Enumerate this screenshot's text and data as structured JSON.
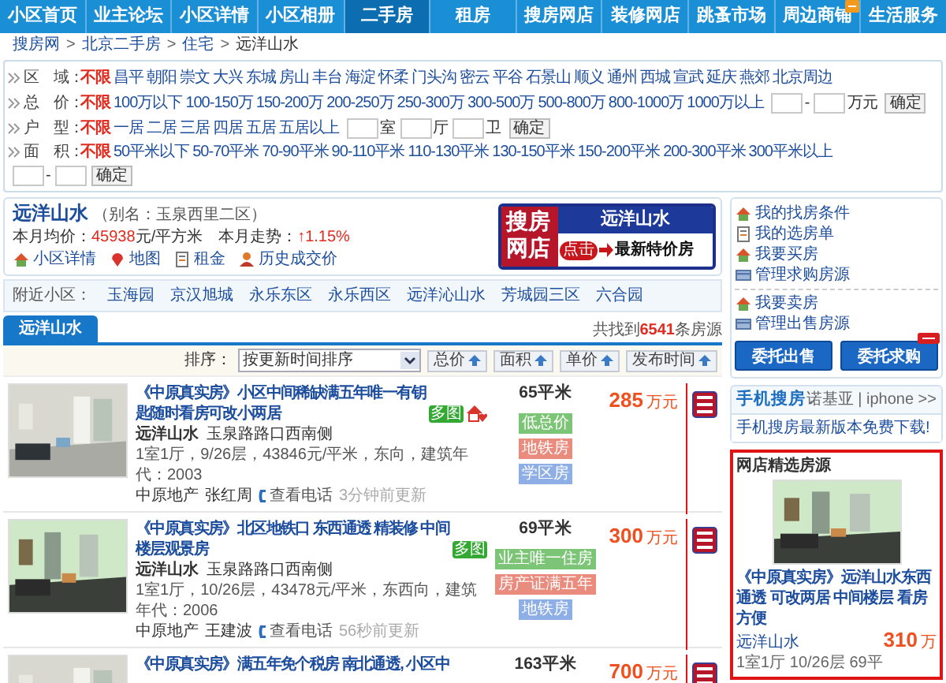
{
  "nav": [
    {
      "label": "小区首页",
      "selected": false,
      "badge": false
    },
    {
      "label": "业主论坛",
      "selected": false,
      "badge": false
    },
    {
      "label": "小区详情",
      "selected": false,
      "badge": false
    },
    {
      "label": "小区相册",
      "selected": false,
      "badge": false
    },
    {
      "label": "二手房",
      "selected": true,
      "badge": false
    },
    {
      "label": "租房",
      "selected": false,
      "badge": false
    },
    {
      "label": "搜房网店",
      "selected": false,
      "badge": false
    },
    {
      "label": "装修网店",
      "selected": false,
      "badge": false
    },
    {
      "label": "跳蚤市场",
      "selected": false,
      "badge": false
    },
    {
      "label": "周边商铺",
      "selected": false,
      "badge": true
    },
    {
      "label": "生活服务",
      "selected": false,
      "badge": false
    }
  ],
  "breadcrumb": {
    "separator": ">",
    "items": [
      "搜房网",
      "北京二手房",
      "住宅"
    ],
    "current": "远洋山水"
  },
  "filters": [
    {
      "label": "区　域：",
      "options": [
        {
          "label": "不限",
          "selected": true
        },
        {
          "label": "昌平",
          "selected": false
        },
        {
          "label": "朝阳",
          "selected": false
        },
        {
          "label": "崇文",
          "selected": false
        },
        {
          "label": "大兴",
          "selected": false
        },
        {
          "label": "东城",
          "selected": false
        },
        {
          "label": "房山",
          "selected": false
        },
        {
          "label": "丰台",
          "selected": false
        },
        {
          "label": "海淀",
          "selected": false
        },
        {
          "label": "怀柔",
          "selected": false
        },
        {
          "label": "门头沟",
          "selected": false
        },
        {
          "label": "密云",
          "selected": false
        },
        {
          "label": "平谷",
          "selected": false
        },
        {
          "label": "石景山",
          "selected": false
        },
        {
          "label": "顺义",
          "selected": false
        },
        {
          "label": "通州",
          "selected": false
        },
        {
          "label": "西城",
          "selected": false
        },
        {
          "label": "宣武",
          "selected": false
        },
        {
          "label": "延庆",
          "selected": false
        },
        {
          "label": "燕郊",
          "selected": false
        },
        {
          "label": "北京周边",
          "selected": false
        }
      ]
    },
    {
      "label": "总　价：",
      "options": [
        {
          "label": "不限",
          "selected": true
        },
        {
          "label": "100万以下",
          "selected": false
        },
        {
          "label": "100-150万",
          "selected": false
        },
        {
          "label": "150-200万",
          "selected": false
        },
        {
          "label": "200-250万",
          "selected": false
        },
        {
          "label": "250-300万",
          "selected": false
        },
        {
          "label": "300-500万",
          "selected": false
        },
        {
          "label": "500-800万",
          "selected": false
        },
        {
          "label": "800-1000万",
          "selected": false
        },
        {
          "label": "1000万以上",
          "selected": false
        }
      ],
      "inputs": [
        {
          "kind": "field",
          "after": "-"
        },
        {
          "kind": "field",
          "after": "万元"
        }
      ],
      "button": "确定"
    },
    {
      "label": "户　型：",
      "options": [
        {
          "label": "不限",
          "selected": true
        },
        {
          "label": "一居",
          "selected": false
        },
        {
          "label": "二居",
          "selected": false
        },
        {
          "label": "三居",
          "selected": false
        },
        {
          "label": "四居",
          "selected": false
        },
        {
          "label": "五居",
          "selected": false
        },
        {
          "label": "五居以上",
          "selected": false
        }
      ],
      "inputs": [
        {
          "kind": "field",
          "after": "室"
        },
        {
          "kind": "field",
          "after": "厅"
        },
        {
          "kind": "field",
          "after": "卫"
        }
      ],
      "button": "确定"
    },
    {
      "label": "面　积：",
      "options": [
        {
          "label": "不限",
          "selected": true
        },
        {
          "label": "50平米以下",
          "selected": false
        },
        {
          "label": "50-70平米",
          "selected": false
        },
        {
          "label": "70-90平米",
          "selected": false
        },
        {
          "label": "90-110平米",
          "selected": false
        },
        {
          "label": "110-130平米",
          "selected": false
        },
        {
          "label": "130-150平米",
          "selected": false
        },
        {
          "label": "150-200平米",
          "selected": false
        },
        {
          "label": "200-300平米",
          "selected": false
        },
        {
          "label": "300平米以上",
          "selected": false
        }
      ],
      "inputs": [
        {
          "kind": "field",
          "after": "-"
        },
        {
          "kind": "field"
        }
      ],
      "button": "确定"
    }
  ],
  "community": {
    "name": "远洋山水",
    "alias": "（别名：玉泉西里二区）",
    "stats": "本月均价：**45938**元/平方米　本月走势：**↑1.15%**",
    "links": [
      {
        "label": "小区详情",
        "kind": "house"
      },
      {
        "label": "地图",
        "kind": "pin"
      },
      {
        "label": "租金",
        "kind": "doc"
      },
      {
        "label": "历史成交价",
        "kind": "person"
      }
    ]
  },
  "banner": {
    "logo": "搜房网店",
    "title": "远洋山水",
    "click": "点击",
    "text": "最新特价房"
  },
  "nearby": {
    "label": "附近小区：",
    "items": [
      "玉海园",
      "京汉旭城",
      "永乐东区",
      "永乐西区",
      "远洋沁山水",
      "芳城园三区",
      "六合园"
    ]
  },
  "tabs": [
    {
      "label": "远洋山水",
      "selected": true
    }
  ],
  "result": "共找到**6541**条房源",
  "sort": {
    "label": "排序：",
    "select": "按更新时间排序",
    "buttons": [
      "总价",
      "面积",
      "单价",
      "发布时间"
    ]
  },
  "listings": [
    {
      "title": "《中原真实房》小区中间稀缺满五年唯一有钥匙随时看房可改小两居",
      "badge": "多图",
      "featured": true,
      "community": "远洋山水",
      "address": "玉泉路路口西南侧",
      "details": "1室1厅，9/26层，43846元/平米，东向，建筑年代：2003",
      "agency": "中原地产",
      "agent": "张红周",
      "phone": "查看电话",
      "updated": "3分钟前更新",
      "area": "65平米",
      "tags": [
        {
          "label": "低总价",
          "color": "#7cc576"
        },
        {
          "label": "地铁房",
          "color": "#e98c7e"
        },
        {
          "label": "学区房",
          "color": "#8eaee6"
        }
      ],
      "price": "285",
      "unit": "万元"
    },
    {
      "title": "《中原真实房》北区地铁口 东西通透 精装修 中间楼层观景房",
      "badge": "多图",
      "featured": false,
      "community": "远洋山水",
      "address": "玉泉路路口西南侧",
      "details": "1室1厅，10/26层，43478元/平米，东西向，建筑年代：2006",
      "agency": "中原地产",
      "agent": "王建波",
      "phone": "查看电话",
      "updated": "56秒前更新",
      "area": "69平米",
      "tags": [
        {
          "label": "业主唯一住房",
          "color": "#7cc576"
        },
        {
          "label": "房产证满五年",
          "color": "#e98c7e"
        },
        {
          "label": "地铁房",
          "color": "#8eaee6"
        }
      ],
      "price": "300",
      "unit": "万元"
    },
    {
      "title": "《中原真实房》满五年免个税房 南北通透, 小区中",
      "area": "163平米",
      "price": "700",
      "unit": "万元"
    }
  ],
  "sidebar": {
    "links": [
      {
        "label": "我的找房条件",
        "kind": "house"
      },
      {
        "label": "我的选房单",
        "kind": "doc"
      },
      {
        "label": "我要买房",
        "kind": "house"
      },
      {
        "label": "管理求购房源",
        "kind": "card"
      },
      {
        "label": "我要卖房",
        "kind": "house"
      },
      {
        "label": "管理出售房源",
        "kind": "card"
      }
    ],
    "buttons": [
      {
        "label": "委托出售",
        "new": false
      },
      {
        "label": "委托求购",
        "new": true
      }
    ],
    "mobile": {
      "title": "手机搜房",
      "platforms": "诺基亚 | iphone >>",
      "download": "手机搜房最新版本免费下载!"
    },
    "picks": {
      "title": "网店精选房源",
      "listing_title": "《中原真实房》远洋山水东西通透 可改两居 中间楼层 看房方便",
      "community": "远洋山水",
      "price": "310",
      "unit": "万",
      "details": "1室1厅  10/26层  69平"
    }
  }
}
